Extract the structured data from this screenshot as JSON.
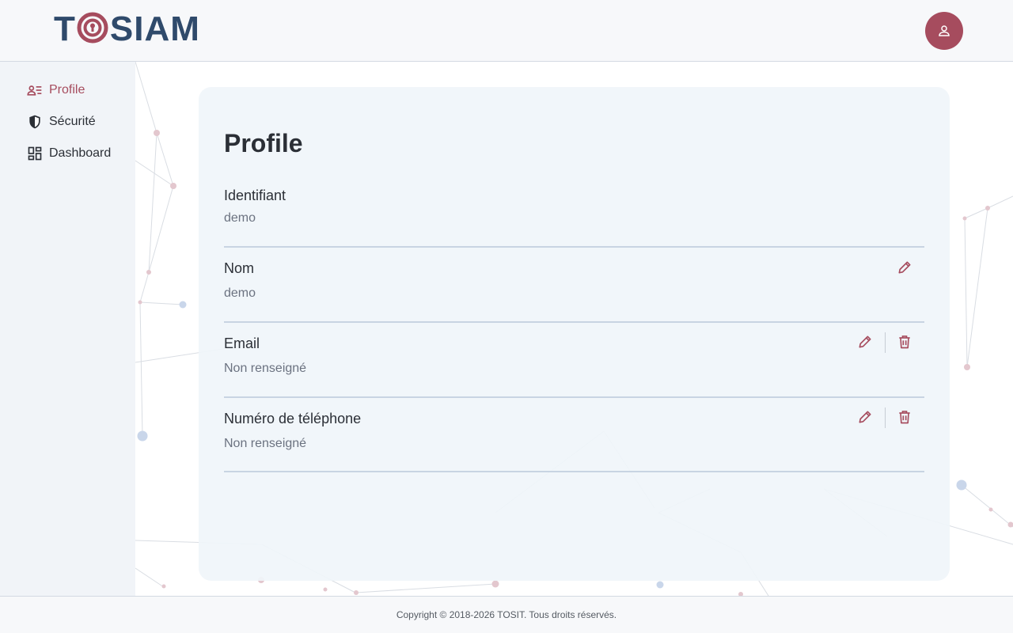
{
  "header": {
    "logo_text_left": "T",
    "logo_text_right": "SIAM",
    "avatar_icon": "user-icon"
  },
  "colors": {
    "accent": "#a64c5e",
    "logo_blue": "#2f4a6b"
  },
  "sidebar": {
    "items": [
      {
        "label": "Profile",
        "icon": "profile-icon",
        "active": true
      },
      {
        "label": "Sécurité",
        "icon": "shield-icon",
        "active": false
      },
      {
        "label": "Dashboard",
        "icon": "dashboard-icon",
        "active": false
      }
    ]
  },
  "main": {
    "title": "Profile",
    "fields": [
      {
        "label": "Identifiant",
        "value": "demo"
      },
      {
        "label": "Nom",
        "value": "demo"
      },
      {
        "label": "Email",
        "value": "Non renseigné"
      },
      {
        "label": "Numéro de téléphone",
        "value": "Non renseigné"
      }
    ]
  },
  "footer": {
    "copyright": "Copyright © 2018-2026 TOSIT. Tous droits réservés."
  }
}
